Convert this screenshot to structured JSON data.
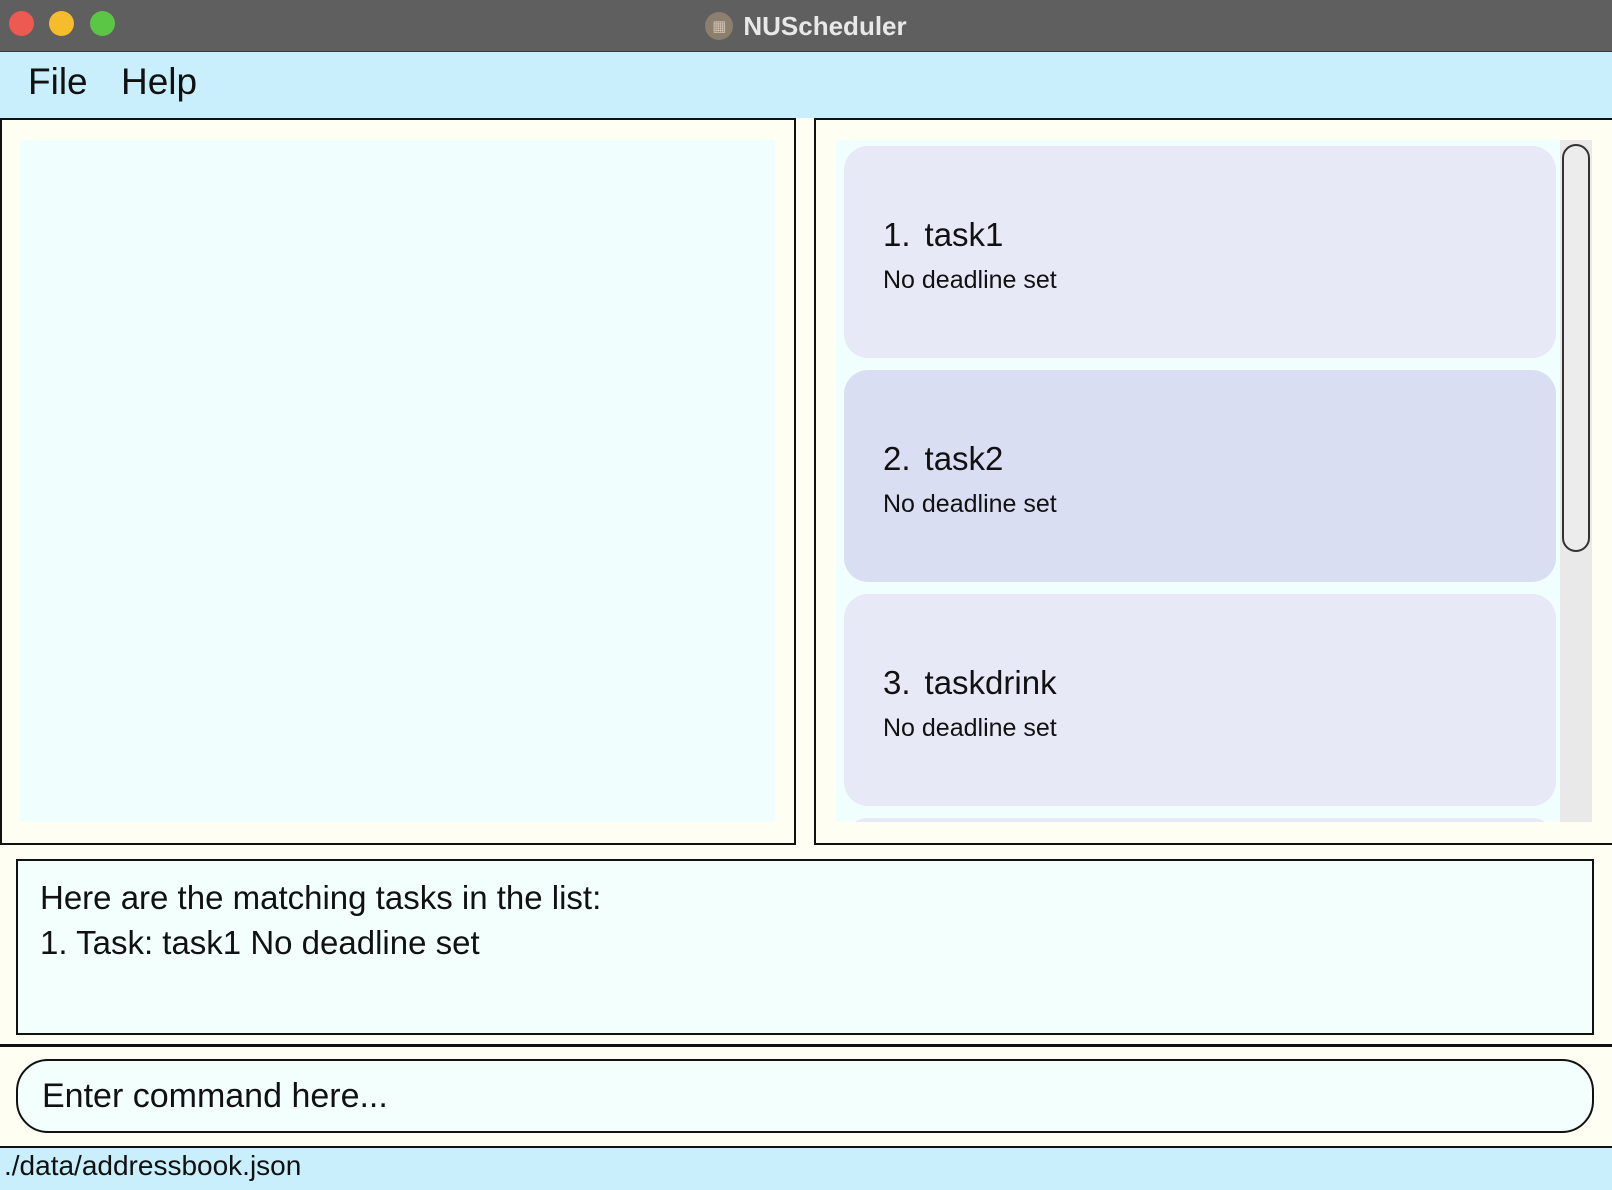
{
  "window": {
    "title": "NUScheduler",
    "icon": "calendar-icon"
  },
  "menu": {
    "file": "File",
    "help": "Help"
  },
  "tasks": [
    {
      "index": "1.",
      "name": "task1",
      "deadline": "No deadline set"
    },
    {
      "index": "2.",
      "name": "task2",
      "deadline": "No deadline set"
    },
    {
      "index": "3.",
      "name": "taskdrink",
      "deadline": "No deadline set"
    }
  ],
  "result": {
    "line1": "Here are the matching tasks in the list:",
    "line2": "1. Task: task1 No deadline set"
  },
  "command": {
    "placeholder": "Enter command here..."
  },
  "status": {
    "path": "./data/addressbook.json"
  },
  "colors": {
    "menubar": "#c9effd",
    "panel_fill": "#f0fffe",
    "card": "#e7e9f7",
    "card_selected": "#d9def2"
  }
}
